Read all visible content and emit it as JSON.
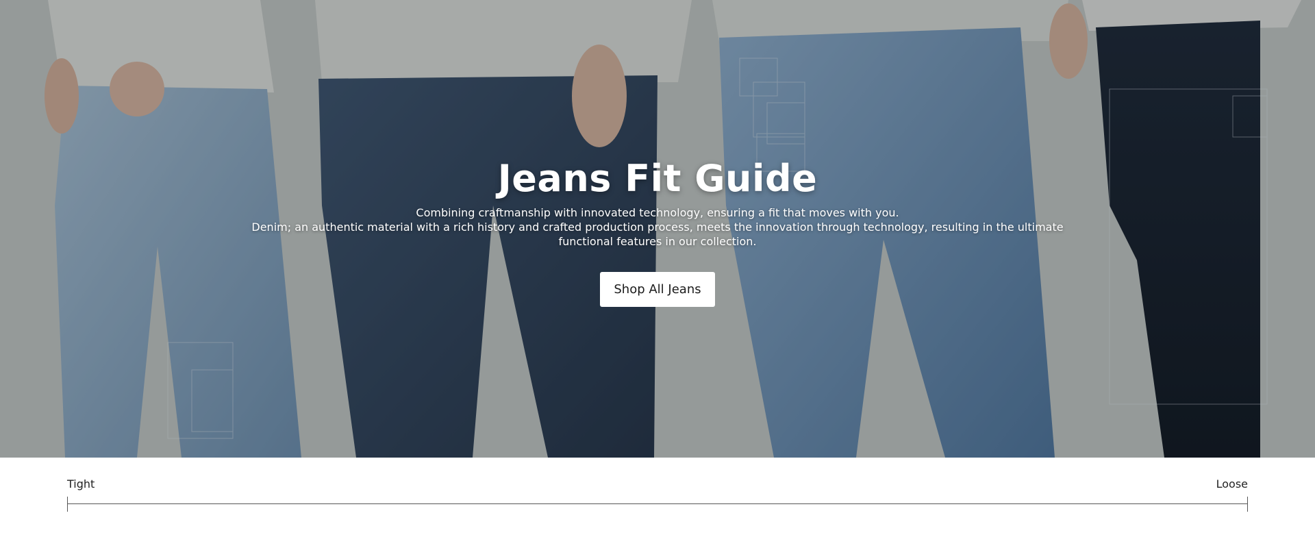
{
  "hero": {
    "title": "Jeans Fit Guide",
    "subtitle_line1": "Combining craftmanship with innovated technology, ensuring a fit that moves with you.",
    "subtitle_line2": "Denim; an authentic material with a rich history and crafted production process, meets the innovation through technology, resulting in the ultimate functional features in our collection.",
    "cta_label": "Shop All Jeans"
  },
  "fit_scale": {
    "left_label": "Tight",
    "right_label": "Loose"
  }
}
